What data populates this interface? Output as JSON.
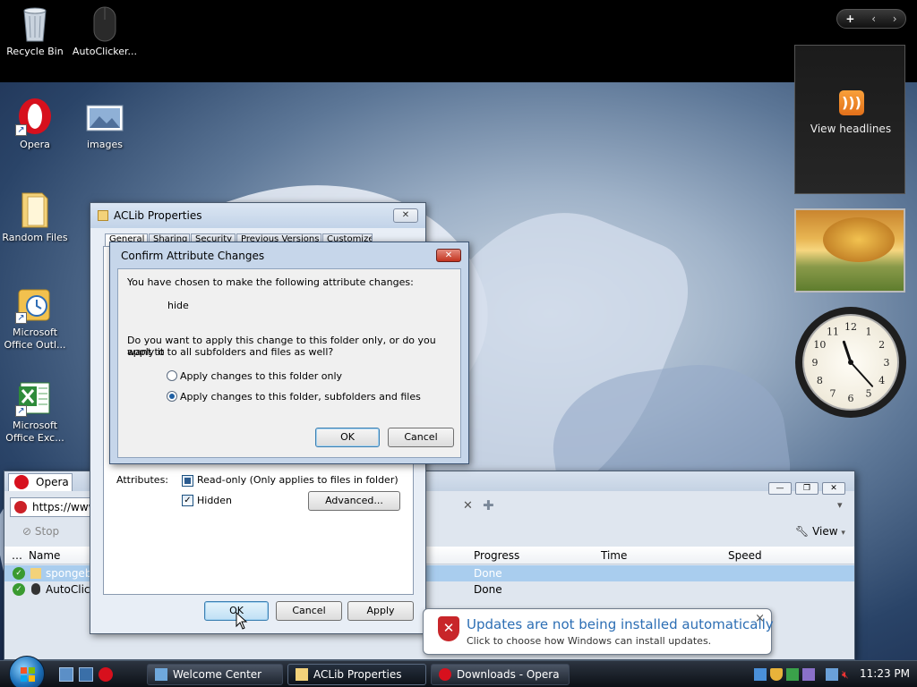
{
  "desktop": {
    "icons": [
      {
        "label": "Recycle Bin",
        "icon": "recycle-bin-icon"
      },
      {
        "label": "AutoClicker...",
        "icon": "mouse-icon"
      },
      {
        "label": "Opera",
        "icon": "opera-icon"
      },
      {
        "label": "images",
        "icon": "image-folder-icon"
      },
      {
        "label": "Random Files",
        "icon": "folder-icon"
      },
      {
        "label": "Microsoft Office Outl...",
        "icon": "outlook-icon"
      },
      {
        "label": "Microsoft Office Exc...",
        "icon": "excel-icon"
      }
    ]
  },
  "gadgets": {
    "toolbar": {
      "add": "+",
      "prev": "‹",
      "next": "›"
    },
    "rss_label": "View headlines",
    "clock": {
      "hour": 11,
      "minute": 23
    }
  },
  "aclib": {
    "title": "ACLib Properties",
    "tabs": [
      "General",
      "Sharing",
      "Security",
      "Previous Versions",
      "Customize"
    ],
    "attributes_label": "Attributes:",
    "readonly_label": "Read-only (Only applies to files in folder)",
    "hidden_label": "Hidden",
    "advanced_button": "Advanced...",
    "ok_button": "OK",
    "cancel_button": "Cancel",
    "apply_button": "Apply"
  },
  "confirm": {
    "title": "Confirm Attribute Changes",
    "intro": "You have chosen to make the following attribute changes:",
    "change": "hide",
    "question_line1": "Do you want to apply this change to this folder only, or do you want to",
    "question_line2": "apply it to all subfolders and files as well?",
    "option_folder_only": "Apply changes to this folder only",
    "option_all": "Apply changes to this folder, subfolders and files",
    "selected_option": "all",
    "ok_button": "OK",
    "cancel_button": "Cancel"
  },
  "opera": {
    "tab_label": "Opera",
    "address": "https://www",
    "stop_label": "Stop",
    "view_label": "View",
    "columns": {
      "name": "Name",
      "progress": "Progress",
      "time": "Time",
      "speed": "Speed"
    },
    "rows": [
      {
        "name": "spongebo",
        "progress": "Done",
        "selected": true
      },
      {
        "name": "AutoClick",
        "progress": "Done",
        "selected": false
      }
    ]
  },
  "notification": {
    "title": "Updates are not being installed automatically",
    "message": "Click to choose how Windows can install updates."
  },
  "taskbar": {
    "buttons": [
      {
        "label": "Welcome Center",
        "icon": "welcome-center-icon",
        "active": false
      },
      {
        "label": "ACLib Properties",
        "icon": "folder-icon",
        "active": true
      },
      {
        "label": "Downloads - Opera",
        "icon": "opera-icon",
        "active": false
      }
    ],
    "clock": "11:23 PM"
  },
  "colors": {
    "accent": "#1f5fa3",
    "balloon_title": "#2c6eb4",
    "opera_red": "#d7101d",
    "selected_row": "#a9cdee"
  }
}
